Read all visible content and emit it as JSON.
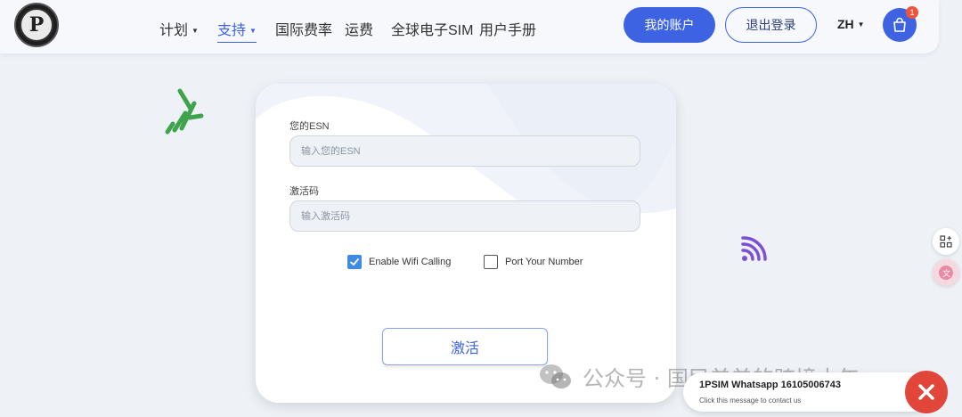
{
  "header": {
    "logo_text": "P",
    "nav": [
      {
        "label": "计划",
        "has_caret": true
      },
      {
        "label": "支持",
        "has_caret": true,
        "active": true
      },
      {
        "label": "国际费率"
      },
      {
        "label": "运费"
      },
      {
        "label": "全球电子SIM"
      },
      {
        "label": "用户手册"
      }
    ],
    "account_button": "我的账户",
    "logout_button": "退出登录",
    "language": "ZH",
    "cart_badge": "1"
  },
  "form": {
    "esn_label": "您的ESN",
    "esn_placeholder": "输入您的ESN",
    "code_label": "激活码",
    "code_placeholder": "输入激活码",
    "wifi_calling_label": "Enable Wifi Calling",
    "wifi_calling_checked": true,
    "port_number_label": "Port Your Number",
    "port_number_checked": false,
    "activate_button": "激活"
  },
  "watermark": {
    "text": "公众号 · 国民弟弟的跨境十年"
  },
  "whatsapp": {
    "title": "1PSIM Whatsapp 16105006743",
    "subtitle": "Click this message to contact us"
  },
  "colors": {
    "primary": "#3d63e3",
    "badge": "#f0533b",
    "close": "#e2463a",
    "signal_green": "#3fa34d",
    "wifi_purple": "#7b4fd6"
  },
  "icons": {
    "cart": "shopping-bag-icon",
    "signal": "signal-bars-icon",
    "wifi": "wifi-icon",
    "side_tool_1": "apps-add-icon",
    "side_tool_2": "translate-icon",
    "close": "close-icon"
  }
}
